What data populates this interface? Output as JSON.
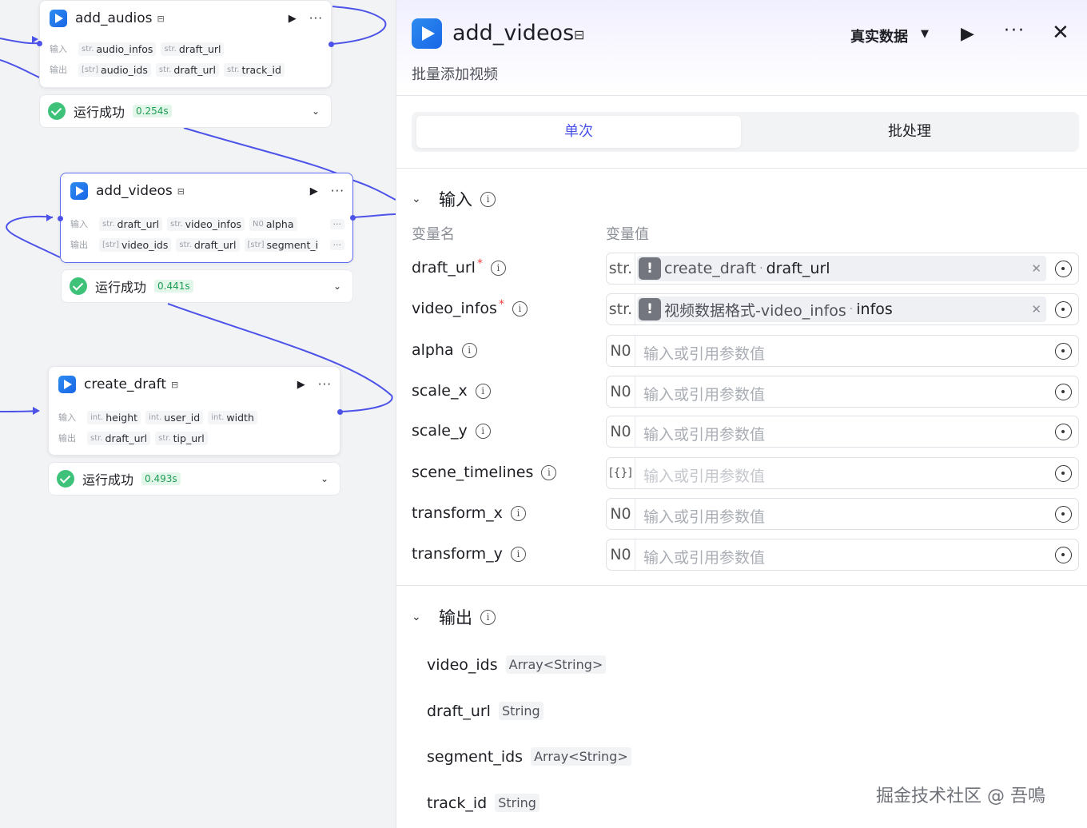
{
  "canvas": {
    "nodes": [
      {
        "title": "add_audios",
        "inputs_label": "输入",
        "inputs": [
          {
            "type": "str.",
            "name": "audio_infos"
          },
          {
            "type": "str.",
            "name": "draft_url"
          }
        ],
        "outputs_label": "输出",
        "outputs": [
          {
            "type": "[str]",
            "name": "audio_ids"
          },
          {
            "type": "str.",
            "name": "draft_url"
          },
          {
            "type": "str.",
            "name": "track_id"
          }
        ],
        "result_text": "运行成功",
        "result_time": "0.254s"
      },
      {
        "title": "add_videos",
        "inputs_label": "输入",
        "inputs": [
          {
            "type": "str.",
            "name": "draft_url"
          },
          {
            "type": "str.",
            "name": "video_infos"
          },
          {
            "type": "N0",
            "name": "alpha"
          }
        ],
        "outputs_label": "输出",
        "outputs": [
          {
            "type": "[str]",
            "name": "video_ids"
          },
          {
            "type": "str.",
            "name": "draft_url"
          },
          {
            "type": "[str]",
            "name": "segment_ids"
          }
        ],
        "result_text": "运行成功",
        "result_time": "0.441s"
      },
      {
        "title": "create_draft",
        "inputs_label": "输入",
        "inputs": [
          {
            "type": "int.",
            "name": "height"
          },
          {
            "type": "int.",
            "name": "user_id"
          },
          {
            "type": "int.",
            "name": "width"
          }
        ],
        "outputs_label": "输出",
        "outputs": [
          {
            "type": "str.",
            "name": "draft_url"
          },
          {
            "type": "str.",
            "name": "tip_url"
          }
        ],
        "result_text": "运行成功",
        "result_time": "0.493s"
      }
    ],
    "more_label": "···"
  },
  "panel": {
    "title": "add_videos",
    "description": "批量添加视频",
    "data_mode": "真实数据",
    "tabs": [
      "单次",
      "批处理"
    ],
    "input_section": {
      "title": "输入",
      "col_name": "变量名",
      "col_value": "变量值",
      "params": [
        {
          "name": "draft_url",
          "required": "*",
          "type": "str.",
          "ref_node": "create_draft",
          "ref_var": "draft_url"
        },
        {
          "name": "video_infos",
          "required": "*",
          "type": "str.",
          "ref_node": "视频数据格式-video_infos",
          "ref_var": "infos"
        },
        {
          "name": "alpha",
          "type": "N0",
          "placeholder": "输入或引用参数值"
        },
        {
          "name": "scale_x",
          "type": "N0",
          "placeholder": "输入或引用参数值"
        },
        {
          "name": "scale_y",
          "type": "N0",
          "placeholder": "输入或引用参数值"
        },
        {
          "name": "scene_timelines",
          "type": "[{}]",
          "placeholder": "输入或引用参数值"
        },
        {
          "name": "transform_x",
          "type": "N0",
          "placeholder": "输入或引用参数值"
        },
        {
          "name": "transform_y",
          "type": "N0",
          "placeholder": "输入或引用参数值"
        }
      ]
    },
    "output_section": {
      "title": "输出",
      "outputs": [
        {
          "name": "video_ids",
          "type": "Array<String>"
        },
        {
          "name": "draft_url",
          "type": "String"
        },
        {
          "name": "segment_ids",
          "type": "Array<String>"
        },
        {
          "name": "track_id",
          "type": "String"
        }
      ]
    }
  },
  "watermark": "掘金技术社区 @ 吾鳴",
  "colors": {
    "accent": "#4d53e8",
    "success": "#3ec27a",
    "required": "#f53f3f"
  }
}
